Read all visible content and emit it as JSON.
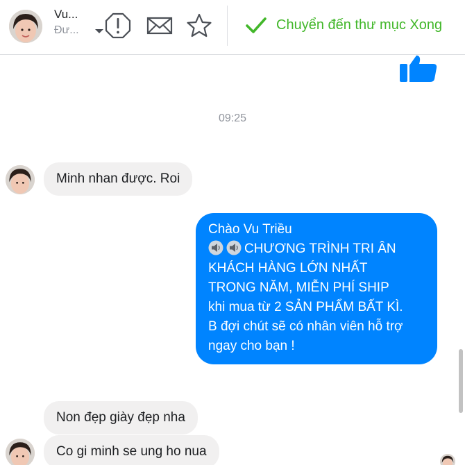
{
  "header": {
    "contact_name": "Vu...",
    "contact_status": "Đư...",
    "actions": {
      "report_icon": "exclamation-octagon",
      "message_icon": "envelope",
      "star_icon": "star"
    },
    "done_button": {
      "label": "Chuyển đến thư mục Xong",
      "icon": "checkmark",
      "color": "#42b72a"
    }
  },
  "conversation": {
    "top_reaction": "thumbs-up",
    "timestamp": "09:25",
    "messages": [
      {
        "direction": "incoming",
        "text": "Minh nhan được. Roi"
      },
      {
        "direction": "outgoing",
        "lines": [
          "Chào Vu Triều",
          "CHƯƠNG TRÌNH TRI ÂN",
          "KHÁCH HÀNG LỚN NHẤT",
          "TRONG NĂM, MIỄN PHÍ SHIP",
          "khi mua từ 2 SẢN PHẨM BẤT KÌ.",
          "B đợi chút sẽ có nhân viên hỗ trợ",
          "ngay cho bạn !"
        ],
        "emoji": "speaker-icon"
      },
      {
        "direction": "incoming",
        "text": "Non đẹp giày đẹp nha"
      },
      {
        "direction": "incoming",
        "text": "Co gi minh se ung ho nua"
      }
    ]
  },
  "colors": {
    "outgoing_bubble": "#0084ff",
    "incoming_bubble": "#f1f0f0",
    "accent_green": "#42b72a"
  }
}
